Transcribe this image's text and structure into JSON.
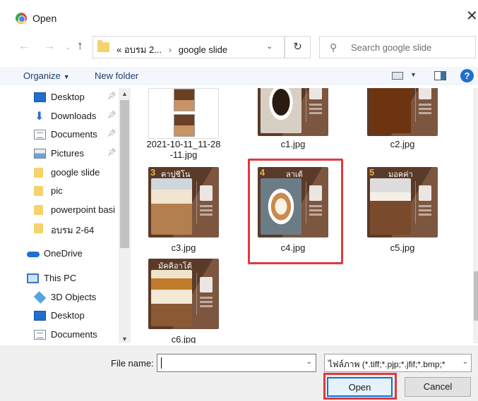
{
  "window": {
    "title": "Open",
    "close_glyph": "✕"
  },
  "address_bar": {
    "overflow_glyph": "«",
    "segments": [
      "อบรม 2...",
      "google slide"
    ],
    "separator": "›"
  },
  "search": {
    "placeholder": "Search google slide"
  },
  "toolbar": {
    "organize_label": "Organize",
    "new_folder_label": "New folder",
    "help_glyph": "?"
  },
  "navigation": {
    "items": [
      {
        "label": "Desktop",
        "icon": "desktop-icon",
        "pinned": true
      },
      {
        "label": "Downloads",
        "icon": "downloads-icon",
        "pinned": true
      },
      {
        "label": "Documents",
        "icon": "documents-icon",
        "pinned": true
      },
      {
        "label": "Pictures",
        "icon": "pictures-icon",
        "pinned": true
      },
      {
        "label": "google slide",
        "icon": "folder-icon",
        "pinned": false
      },
      {
        "label": "pic",
        "icon": "folder-icon",
        "pinned": false
      },
      {
        "label": "powerpoint basi",
        "icon": "folder-icon",
        "pinned": false
      },
      {
        "label": "อบรม 2-64",
        "icon": "folder-icon",
        "pinned": false
      },
      {
        "label": "OneDrive",
        "icon": "onedrive-icon",
        "pinned": false
      },
      {
        "label": "This PC",
        "icon": "this-pc-icon",
        "pinned": false
      },
      {
        "label": "3D Objects",
        "icon": "3d-objects-icon",
        "pinned": false
      },
      {
        "label": "Desktop",
        "icon": "desktop-icon",
        "pinned": false
      },
      {
        "label": "Documents",
        "icon": "documents-icon",
        "pinned": false
      }
    ]
  },
  "files": [
    {
      "name": "2021-10-11_11-28-11.jpg",
      "name_line1": "2021-10-11_11-28",
      "name_line2": "-11.jpg",
      "selected": false
    },
    {
      "name": "c1.jpg",
      "selected": false
    },
    {
      "name": "c2.jpg",
      "selected": false
    },
    {
      "name": "c3.jpg",
      "number": "3",
      "thai": "คาปูชิโน",
      "selected": false
    },
    {
      "name": "c4.jpg",
      "number": "4",
      "thai": "ลาเต้",
      "selected": true
    },
    {
      "name": "c5.jpg",
      "number": "5",
      "thai": "มอคค่า",
      "selected": false
    },
    {
      "name": "c6.jpg",
      "thai": "มัคคิอาโต้",
      "selected": false
    }
  ],
  "footer": {
    "file_name_label": "File name:",
    "file_name_value": "",
    "filter_value": "ไฟล์ภาพ (*.tiff;*.pjp;*.jfif;*.bmp;*",
    "open_label": "Open",
    "cancel_label": "Cancel"
  },
  "colors": {
    "selection_highlight": "#e0393e",
    "accent": "#0078d7",
    "toolbar_bg": "#f3f6fb"
  }
}
